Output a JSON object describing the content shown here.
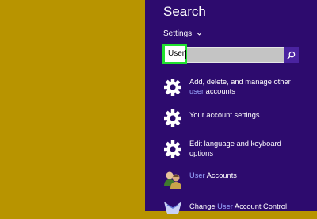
{
  "charm": {
    "title": "Search",
    "scope": "Settings",
    "query": "User"
  },
  "results": [
    {
      "pre": "Add, delete, and manage other ",
      "hl": "user",
      "post": " accounts",
      "icon": "gear-icon"
    },
    {
      "pre": "Your account settings",
      "hl": "",
      "post": "",
      "icon": "gear-icon"
    },
    {
      "pre": "Edit language and keyboard options",
      "hl": "",
      "post": "",
      "icon": "gear-icon"
    },
    {
      "pre": "",
      "hl": "User",
      "post": " Accounts",
      "icon": "user-accounts-icon"
    },
    {
      "pre": "Change ",
      "hl": "User",
      "post": " Account Control",
      "icon": "uac-icon"
    }
  ],
  "colors": {
    "desktop": "#b89400",
    "charm_bg": "#2d0b6e",
    "highlight_text": "#9aa7ff",
    "focus_ring": "#21e02f"
  }
}
